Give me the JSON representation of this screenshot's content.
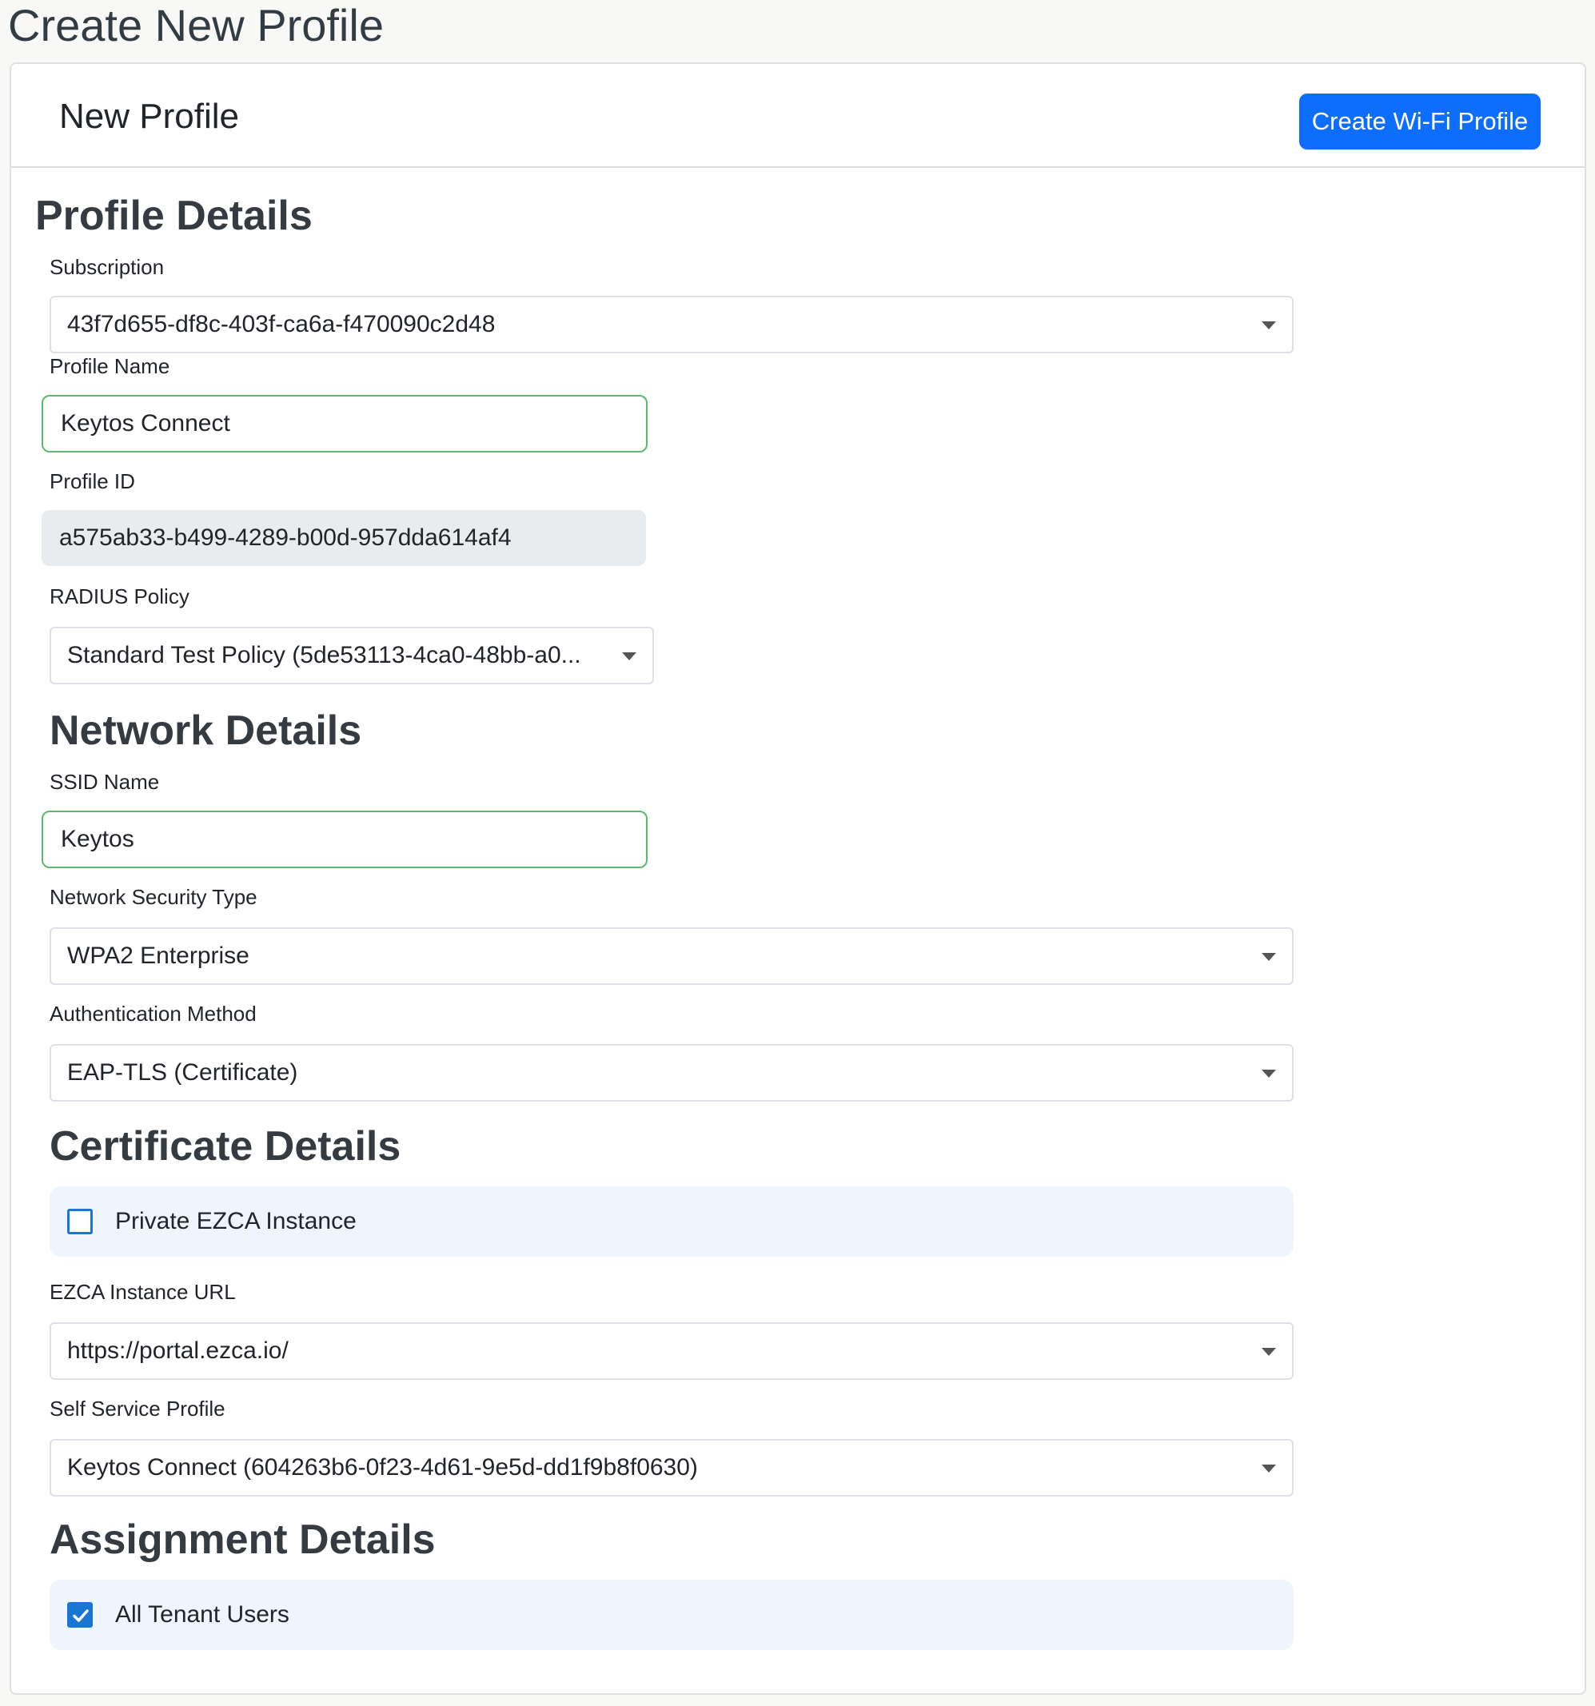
{
  "page": {
    "title": "Create New Profile"
  },
  "card": {
    "header_title": "New Profile",
    "create_button_label": "Create Wi-Fi Profile"
  },
  "profile_details": {
    "heading": "Profile Details",
    "subscription": {
      "label": "Subscription",
      "value": "43f7d655-df8c-403f-ca6a-f470090c2d48"
    },
    "profile_name": {
      "label": "Profile Name",
      "value": "Keytos Connect"
    },
    "profile_id": {
      "label": "Profile ID",
      "value": "a575ab33-b499-4289-b00d-957dda614af4"
    },
    "radius_policy": {
      "label": "RADIUS Policy",
      "value": "Standard Test Policy (5de53113-4ca0-48bb-a0..."
    }
  },
  "network_details": {
    "heading": "Network Details",
    "ssid_name": {
      "label": "SSID Name",
      "value": "Keytos"
    },
    "security_type": {
      "label": "Network Security Type",
      "value": "WPA2 Enterprise"
    },
    "auth_method": {
      "label": "Authentication Method",
      "value": "EAP-TLS (Certificate)"
    }
  },
  "certificate_details": {
    "heading": "Certificate Details",
    "private_instance": {
      "label": "Private EZCA Instance",
      "checked": false
    },
    "instance_url": {
      "label": "EZCA Instance URL",
      "value": "https://portal.ezca.io/"
    },
    "self_service_profile": {
      "label": "Self Service Profile",
      "value": "Keytos Connect (604263b6-0f23-4d61-9e5d-dd1f9b8f0630)"
    }
  },
  "assignment_details": {
    "heading": "Assignment Details",
    "all_tenant_users": {
      "label": "All Tenant Users",
      "checked": true
    }
  },
  "colors": {
    "primary": "#0d6efd",
    "valid_border": "#5cb96a",
    "checkbox": "#1976d2",
    "panel_bg": "#eef5fc",
    "readonly_bg": "#e9ecef"
  },
  "icons": {
    "dropdown": "chevron-down-icon",
    "checkmark": "check-icon"
  }
}
